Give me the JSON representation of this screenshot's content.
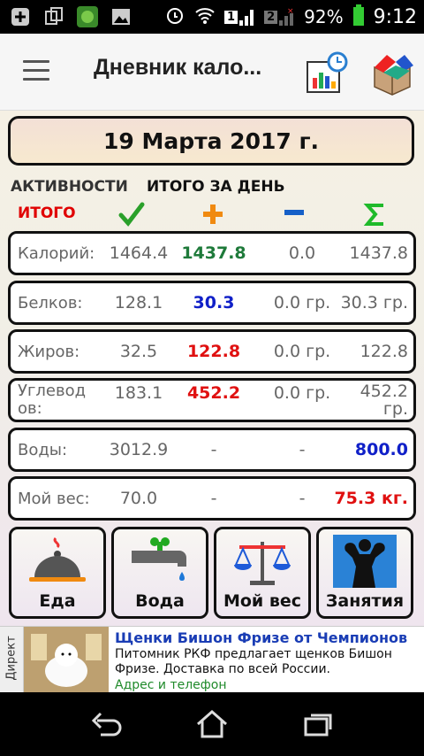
{
  "status_bar": {
    "battery": "92%",
    "time": "9:12",
    "sim1": "1",
    "sim2": "2"
  },
  "app_bar": {
    "title": "Дневник кало..."
  },
  "date": "19 Марта 2017 г.",
  "tabs": {
    "activities": "АКТИВНОСТИ",
    "day_total": "ИТОГО ЗА ДЕНЬ"
  },
  "header": {
    "itogo": "ИТОГО"
  },
  "colors": {
    "food": "#1e7a3a",
    "blue": "#1020c8",
    "red": "#e01010",
    "gray": "#666666"
  },
  "rows": [
    {
      "label": "Калорий:",
      "total": "1464.4",
      "food": "1437.8",
      "food_color": "green",
      "activity": "0.0",
      "sum": "1437.8",
      "sum_color": "gray"
    },
    {
      "label": "Белков:",
      "total": "128.1",
      "food": "30.3",
      "food_color": "blue",
      "activity": "0.0 гр.",
      "sum": "30.3 гр.",
      "sum_color": "gray"
    },
    {
      "label": "Жиров:",
      "total": "32.5",
      "food": "122.8",
      "food_color": "red",
      "activity": "0.0 гр.",
      "sum": "122.8",
      "sum_color": "gray"
    },
    {
      "label": "Углевод ов:",
      "total": "183.1",
      "food": "452.2",
      "food_color": "red",
      "activity": "0.0 гр.",
      "sum": "452.2 гр.",
      "sum_color": "gray"
    },
    {
      "label": "Воды:",
      "total": "3012.9",
      "food": "-",
      "food_color": "gray",
      "activity": "-",
      "sum": "800.0",
      "sum_color": "blue"
    },
    {
      "label": "Мой вес:",
      "total": "70.0",
      "food": "-",
      "food_color": "gray",
      "activity": "-",
      "sum": "75.3 кг.",
      "sum_color": "red"
    }
  ],
  "buttons": [
    {
      "label": "Еда",
      "icon": "food-cloche-icon"
    },
    {
      "label": "Вода",
      "icon": "water-tap-icon"
    },
    {
      "label": "Мой вес",
      "icon": "scales-icon"
    },
    {
      "label": "Занятия",
      "icon": "bodybuilder-icon"
    }
  ],
  "ad": {
    "side_label": "Директ",
    "title": "Щенки Бишон Фризе от Чемпионов",
    "text": "Питомник РКФ предлагает щенков Бишон Фризе. Доставка по всей России.",
    "link": "Адрес и телефон"
  }
}
